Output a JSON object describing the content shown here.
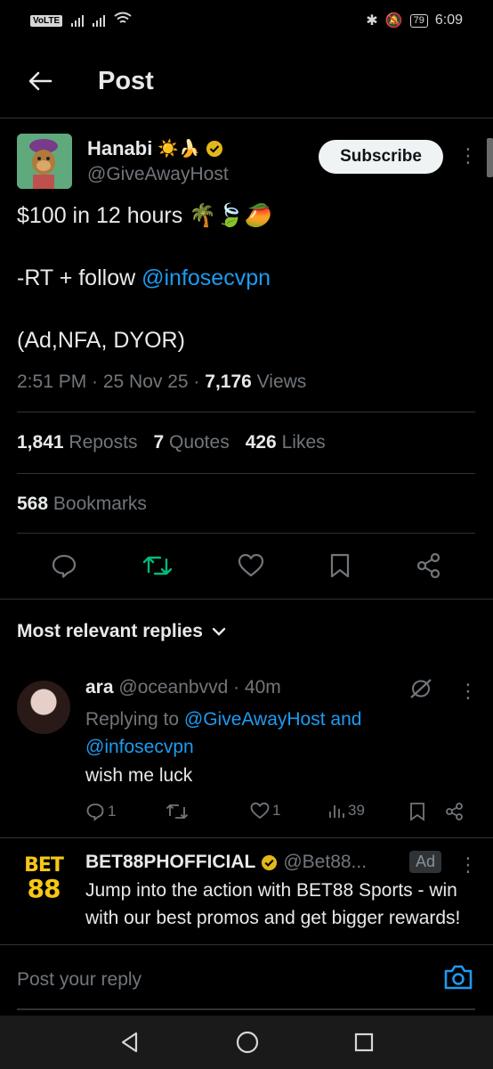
{
  "status_bar": {
    "network": "VoLTE",
    "sim": "2",
    "battery": "79",
    "time": "6:09"
  },
  "header": {
    "title": "Post"
  },
  "post": {
    "author_name": "Hanabi",
    "author_emoji": "☀️🍌",
    "author_handle": "@GiveAwayHost",
    "subscribe_label": "Subscribe",
    "line1": "$100 in 12 hours 🌴🍃🥭",
    "line2_prefix": "-RT + follow ",
    "line2_mention": "@infosecvpn",
    "line3": "(Ad,NFA, DYOR)",
    "time": "2:51 PM · 25 Nov 25 · ",
    "views_count": "7,176",
    "views_label": " Views",
    "reposts_count": "1,841",
    "reposts_label": "Reposts",
    "quotes_count": "7",
    "quotes_label": "Quotes",
    "likes_count": "426",
    "likes_label": "Likes",
    "bookmarks_count": "568",
    "bookmarks_label": "Bookmarks"
  },
  "replies_filter": "Most relevant replies",
  "reply": {
    "name": "ara",
    "handle_time": "@oceanbvvd · 40m",
    "replying_prefix": "Replying to ",
    "replying_to": "@GiveAwayHost and @infosecvpn",
    "text": "wish me luck",
    "comments": "1",
    "likes": "1",
    "views": "39"
  },
  "ad": {
    "logo_line1": "BET",
    "logo_line2": "88",
    "name": "BET88PHOFFICIAL",
    "handle": "@Bet88...",
    "badge": "Ad",
    "text": "Jump into the action with BET88 Sports - win with our best promos and get bigger rewards!"
  },
  "composer": {
    "placeholder": "Post your reply"
  },
  "colors": {
    "accent": "#1d9bf0",
    "repost_active": "#00ba7c",
    "verified": "#e2b719"
  }
}
